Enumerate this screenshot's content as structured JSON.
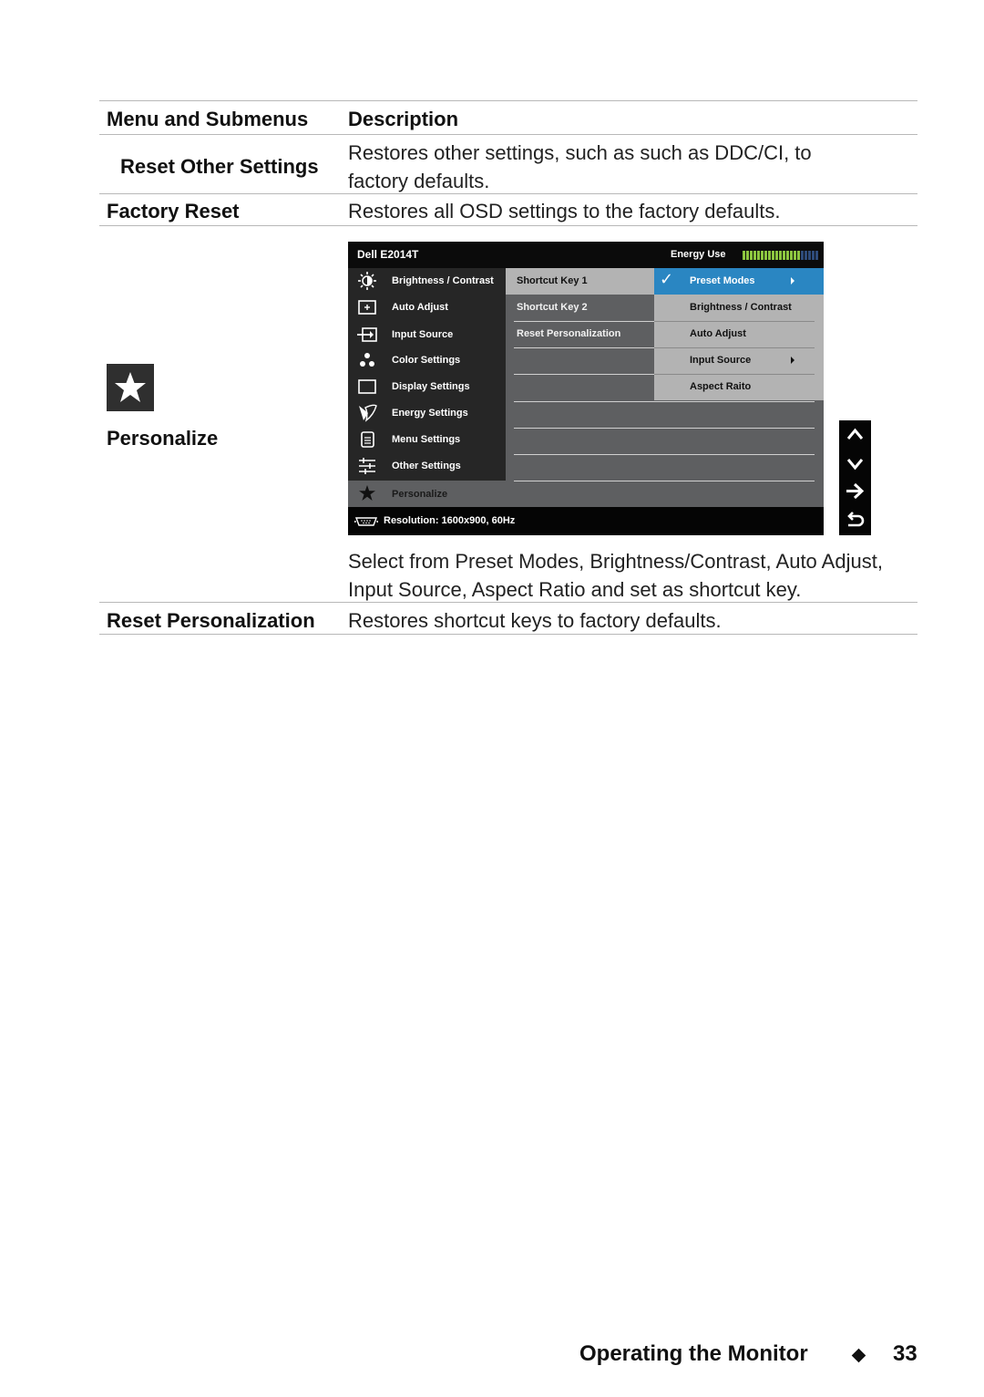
{
  "table": {
    "header": {
      "menu": "Menu and Submenus",
      "description": "Description"
    },
    "rows": [
      {
        "menu": "Reset Other Settings",
        "description": "Restores other settings, such as such as DDC/CI, to factory defaults."
      },
      {
        "menu": "Factory Reset",
        "description": "Restores all OSD settings to the factory defaults."
      },
      {
        "menu": "Personalize",
        "icon": "star-icon",
        "description": "Select from Preset Modes, Brightness/Contrast, Auto Adjust, Input Source, Aspect Ratio and set as shortcut key."
      },
      {
        "menu": "Reset Personalization",
        "description": "Restores shortcut keys to factory defaults."
      }
    ]
  },
  "osd": {
    "model": "Dell E2014T",
    "energy_label": "Energy Use",
    "energy_level": {
      "filled": 16,
      "total": 21
    },
    "colors": {
      "energy_on": "#8cc63f",
      "energy_off": "#2e4b7a",
      "highlight": "#2a86c2"
    },
    "main_menu": [
      {
        "label": "Brightness / Contrast",
        "icon": "brightness-icon"
      },
      {
        "label": "Auto Adjust",
        "icon": "auto-adjust-icon"
      },
      {
        "label": "Input Source",
        "icon": "input-source-icon"
      },
      {
        "label": "Color Settings",
        "icon": "color-settings-icon"
      },
      {
        "label": "Display Settings",
        "icon": "display-settings-icon"
      },
      {
        "label": "Energy Settings",
        "icon": "energy-settings-icon"
      },
      {
        "label": "Menu Settings",
        "icon": "menu-settings-icon"
      },
      {
        "label": "Other Settings",
        "icon": "other-settings-icon"
      },
      {
        "label": "Personalize",
        "icon": "star-icon",
        "selected": true
      }
    ],
    "submenu": [
      {
        "label": "Shortcut Key 1",
        "selected": true
      },
      {
        "label": "Shortcut Key 2"
      },
      {
        "label": "Reset Personalization"
      }
    ],
    "options": [
      {
        "label": "Preset Modes",
        "checked": true,
        "has_submenu": true
      },
      {
        "label": "Brightness / Contrast"
      },
      {
        "label": "Auto Adjust"
      },
      {
        "label": "Input Source",
        "has_submenu": true
      },
      {
        "label": "Aspect Raito"
      }
    ],
    "status": "Resolution:  1600x900, 60Hz",
    "check_glyph": "✓"
  },
  "nav_buttons": [
    "up-icon",
    "down-icon",
    "enter-arrow-icon",
    "back-icon"
  ],
  "footer": {
    "section": "Operating the Monitor",
    "page": "33"
  }
}
